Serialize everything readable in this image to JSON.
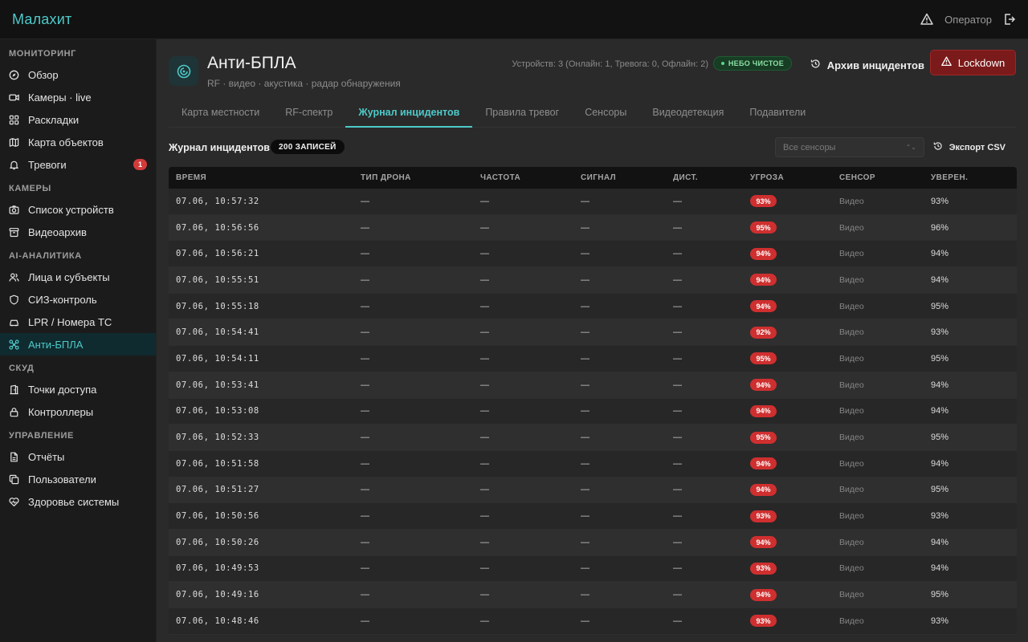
{
  "app": {
    "brand": "Малахит",
    "user": "Оператор"
  },
  "sidebar": {
    "groups": [
      {
        "title": "МОНИТОРИНГ",
        "items": [
          {
            "label": "Обзор",
            "icon": "compass-icon"
          },
          {
            "label": "Камеры · live",
            "icon": "video-icon"
          },
          {
            "label": "Раскладки",
            "icon": "grid-icon"
          },
          {
            "label": "Карта объектов",
            "icon": "map-icon"
          },
          {
            "label": "Тревоги",
            "icon": "bell-icon",
            "badge": "1"
          }
        ]
      },
      {
        "title": "КАМЕРЫ",
        "items": [
          {
            "label": "Список устройств",
            "icon": "camera-icon"
          },
          {
            "label": "Видеоархив",
            "icon": "archive-icon"
          }
        ]
      },
      {
        "title": "AI-АНАЛИТИКА",
        "items": [
          {
            "label": "Лица и субъекты",
            "icon": "users-icon"
          },
          {
            "label": "СИЗ-контроль",
            "icon": "shield-icon"
          },
          {
            "label": "LPR / Номера ТС",
            "icon": "car-icon"
          },
          {
            "label": "Анти-БПЛА",
            "icon": "drone-icon",
            "active": true
          }
        ]
      },
      {
        "title": "СКУД",
        "items": [
          {
            "label": "Точки доступа",
            "icon": "door-icon"
          },
          {
            "label": "Контроллеры",
            "icon": "lock-icon"
          }
        ]
      },
      {
        "title": "УПРАВЛЕНИЕ",
        "items": [
          {
            "label": "Отчёты",
            "icon": "report-icon"
          },
          {
            "label": "Пользователи",
            "icon": "copy-icon"
          },
          {
            "label": "Здоровье системы",
            "icon": "heart-icon"
          }
        ]
      }
    ]
  },
  "header": {
    "title": "Анти-БПЛА",
    "subtitle": "RF · видео · акустика · радар обнаружения",
    "devices": "Устройств: 3 (Онлайн: 1, Тревога: 0, Офлайн: 2)",
    "sky_status": "НЕБО ЧИСТОЕ",
    "archive_label": "Архив инцидентов",
    "lockdown_label": "Lockdown"
  },
  "tabs": [
    {
      "label": "Карта местности"
    },
    {
      "label": "RF-спектр"
    },
    {
      "label": "Журнал инцидентов",
      "active": true
    },
    {
      "label": "Правила тревог"
    },
    {
      "label": "Сенсоры"
    },
    {
      "label": "Видеодетекция"
    },
    {
      "label": "Подавители"
    }
  ],
  "log": {
    "title": "Журнал инцидентов",
    "count": "200 ЗАПИСЕЙ",
    "sensor_filter": "Все сенсоры",
    "export_label": "Экспорт CSV"
  },
  "table": {
    "columns": [
      "ВРЕМЯ",
      "ТИП ДРОНА",
      "ЧАСТОТА",
      "СИГНАЛ",
      "ДИСТ.",
      "УГРОЗА",
      "СЕНСОР",
      "УВЕРЕН."
    ],
    "rows": [
      {
        "time": "07.06, 10:57:32",
        "type": "—",
        "freq": "—",
        "signal": "—",
        "dist": "—",
        "threat": "93%",
        "sensor": "Видео",
        "conf": "93%"
      },
      {
        "time": "07.06, 10:56:56",
        "type": "—",
        "freq": "—",
        "signal": "—",
        "dist": "—",
        "threat": "95%",
        "sensor": "Видео",
        "conf": "96%"
      },
      {
        "time": "07.06, 10:56:21",
        "type": "—",
        "freq": "—",
        "signal": "—",
        "dist": "—",
        "threat": "94%",
        "sensor": "Видео",
        "conf": "94%"
      },
      {
        "time": "07.06, 10:55:51",
        "type": "—",
        "freq": "—",
        "signal": "—",
        "dist": "—",
        "threat": "94%",
        "sensor": "Видео",
        "conf": "94%"
      },
      {
        "time": "07.06, 10:55:18",
        "type": "—",
        "freq": "—",
        "signal": "—",
        "dist": "—",
        "threat": "94%",
        "sensor": "Видео",
        "conf": "95%"
      },
      {
        "time": "07.06, 10:54:41",
        "type": "—",
        "freq": "—",
        "signal": "—",
        "dist": "—",
        "threat": "92%",
        "sensor": "Видео",
        "conf": "93%"
      },
      {
        "time": "07.06, 10:54:11",
        "type": "—",
        "freq": "—",
        "signal": "—",
        "dist": "—",
        "threat": "95%",
        "sensor": "Видео",
        "conf": "95%"
      },
      {
        "time": "07.06, 10:53:41",
        "type": "—",
        "freq": "—",
        "signal": "—",
        "dist": "—",
        "threat": "94%",
        "sensor": "Видео",
        "conf": "94%"
      },
      {
        "time": "07.06, 10:53:08",
        "type": "—",
        "freq": "—",
        "signal": "—",
        "dist": "—",
        "threat": "94%",
        "sensor": "Видео",
        "conf": "94%"
      },
      {
        "time": "07.06, 10:52:33",
        "type": "—",
        "freq": "—",
        "signal": "—",
        "dist": "—",
        "threat": "95%",
        "sensor": "Видео",
        "conf": "95%"
      },
      {
        "time": "07.06, 10:51:58",
        "type": "—",
        "freq": "—",
        "signal": "—",
        "dist": "—",
        "threat": "94%",
        "sensor": "Видео",
        "conf": "94%"
      },
      {
        "time": "07.06, 10:51:27",
        "type": "—",
        "freq": "—",
        "signal": "—",
        "dist": "—",
        "threat": "94%",
        "sensor": "Видео",
        "conf": "95%"
      },
      {
        "time": "07.06, 10:50:56",
        "type": "—",
        "freq": "—",
        "signal": "—",
        "dist": "—",
        "threat": "93%",
        "sensor": "Видео",
        "conf": "93%"
      },
      {
        "time": "07.06, 10:50:26",
        "type": "—",
        "freq": "—",
        "signal": "—",
        "dist": "—",
        "threat": "94%",
        "sensor": "Видео",
        "conf": "94%"
      },
      {
        "time": "07.06, 10:49:53",
        "type": "—",
        "freq": "—",
        "signal": "—",
        "dist": "—",
        "threat": "93%",
        "sensor": "Видео",
        "conf": "94%"
      },
      {
        "time": "07.06, 10:49:16",
        "type": "—",
        "freq": "—",
        "signal": "—",
        "dist": "—",
        "threat": "94%",
        "sensor": "Видео",
        "conf": "95%"
      },
      {
        "time": "07.06, 10:48:46",
        "type": "—",
        "freq": "—",
        "signal": "—",
        "dist": "—",
        "threat": "93%",
        "sensor": "Видео",
        "conf": "93%"
      }
    ]
  },
  "colors": {
    "accent": "#4ec9c9",
    "danger": "#cf2f2f",
    "ok": "#5ed38a"
  }
}
